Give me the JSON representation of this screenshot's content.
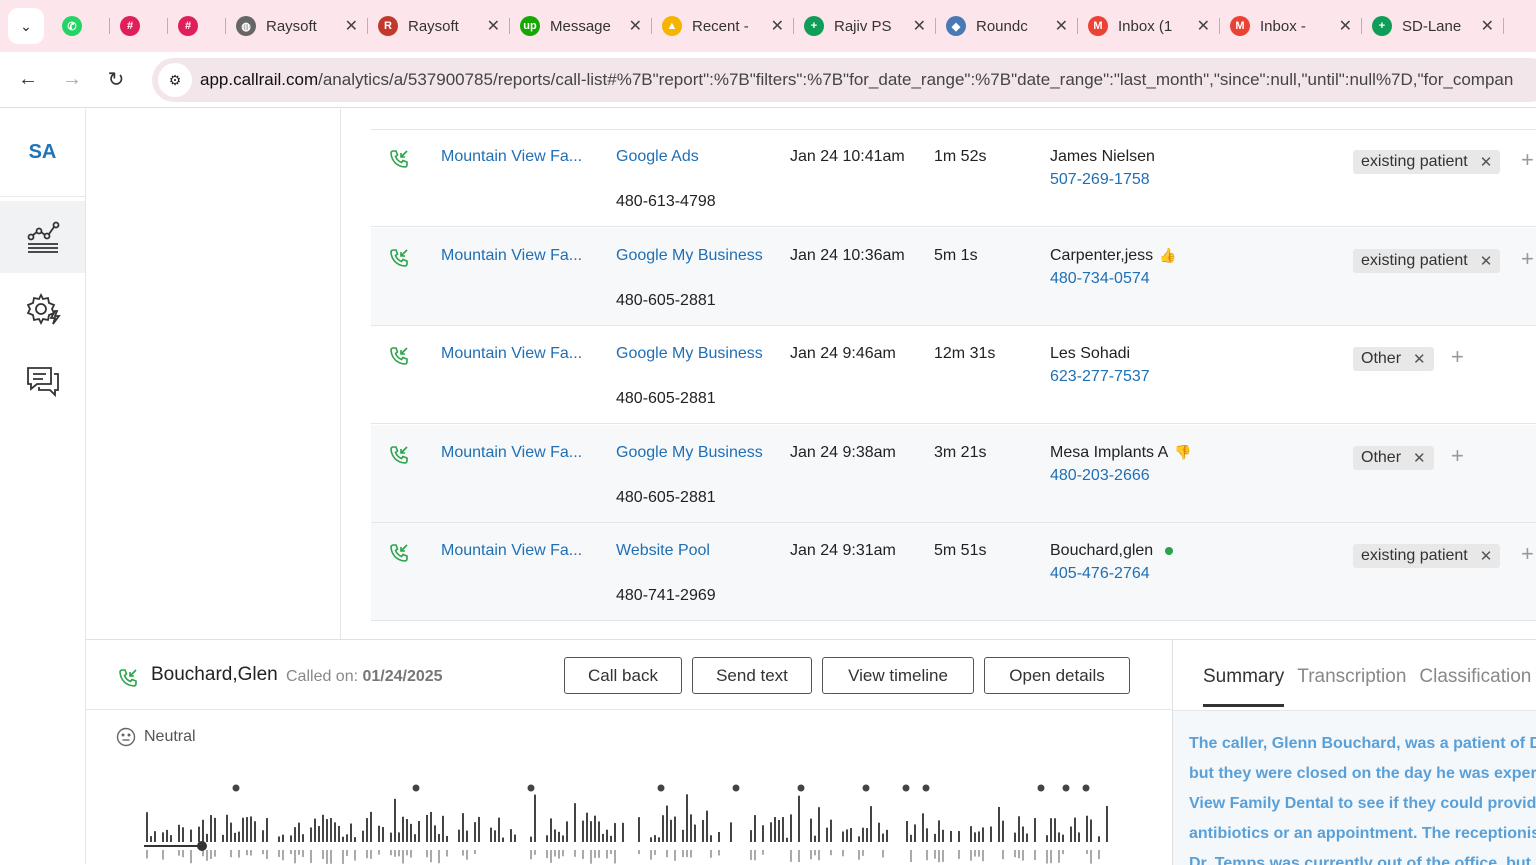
{
  "browser": {
    "tabs": [
      {
        "label": "",
        "icon": "whatsapp-icon",
        "color": "#25d366",
        "glyph": "✆",
        "small": true
      },
      {
        "label": "",
        "icon": "slack-icon",
        "color": "#e01e5a",
        "glyph": "#",
        "small": true
      },
      {
        "label": "",
        "icon": "slack-icon",
        "color": "#e01e5a",
        "glyph": "#",
        "small": true
      },
      {
        "label": "Raysoft",
        "icon": "globe-icon",
        "color": "#666666",
        "glyph": "◍"
      },
      {
        "label": "Raysoft",
        "icon": "raysoft-icon",
        "color": "#c0392b",
        "glyph": "R"
      },
      {
        "label": "Message",
        "icon": "upwork-icon",
        "color": "#14a800",
        "glyph": "up"
      },
      {
        "label": "Recent -",
        "icon": "drive-icon",
        "color": "#f4b400",
        "glyph": "▲"
      },
      {
        "label": "Rajiv PS",
        "icon": "sheets-icon",
        "color": "#0f9d58",
        "glyph": "+"
      },
      {
        "label": "Roundc",
        "icon": "roundcube-icon",
        "color": "#4a7ab5",
        "glyph": "◆"
      },
      {
        "label": "Inbox (1",
        "icon": "gmail-icon",
        "color": "#ea4335",
        "glyph": "M"
      },
      {
        "label": "Inbox -",
        "icon": "gmail-icon",
        "color": "#ea4335",
        "glyph": "M"
      },
      {
        "label": "SD-Lane",
        "icon": "sheets-icon",
        "color": "#0f9d58",
        "glyph": "+"
      }
    ],
    "url_host": "app.callrail.com",
    "url_path": "/analytics/a/537900785/reports/call-list#%7B\"report\":%7B\"filters\":%7B\"for_date_range\":%7B\"date_range\":\"last_month\",\"since\":null,\"until\":null%7D,\"for_compan"
  },
  "rail": {
    "logo": "SA"
  },
  "calls": [
    {
      "company": "Mountain View Fa...",
      "source": "Google Ads",
      "tracking": "480-613-4798",
      "date": "Jan 24 10:41am",
      "duration": "1m 52s",
      "caller": "James Nielsen",
      "caller_phone": "507-269-1758",
      "marker": "",
      "tag": "existing patient"
    },
    {
      "company": "Mountain View Fa...",
      "source": "Google My Business",
      "tracking": "480-605-2881",
      "date": "Jan 24 10:36am",
      "duration": "5m 1s",
      "caller": "Carpenter,jess",
      "caller_phone": "480-734-0574",
      "marker": "thumbs-up",
      "tag": "existing patient"
    },
    {
      "company": "Mountain View Fa...",
      "source": "Google My Business",
      "tracking": "480-605-2881",
      "date": "Jan 24 9:46am",
      "duration": "12m 31s",
      "caller": "Les Sohadi",
      "caller_phone": "623-277-7537",
      "marker": "",
      "tag": "Other"
    },
    {
      "company": "Mountain View Fa...",
      "source": "Google My Business",
      "tracking": "480-605-2881",
      "date": "Jan 24 9:38am",
      "duration": "3m 21s",
      "caller": "Mesa Implants A",
      "caller_phone": "480-203-2666",
      "marker": "thumbs-down",
      "tag": "Other"
    },
    {
      "company": "Mountain View Fa...",
      "source": "Website Pool",
      "tracking": "480-741-2969",
      "date": "Jan 24 9:31am",
      "duration": "5m 51s",
      "caller": "Bouchard,glen",
      "caller_phone": "405-476-2764",
      "marker": "dot",
      "tag": "existing patient"
    }
  ],
  "detail": {
    "caller_name": "Bouchard,Glen",
    "called_on_label": "Called on:",
    "called_on_date": "01/24/2025",
    "buttons": {
      "call_back": "Call back",
      "send_text": "Send text",
      "view_timeline": "View timeline",
      "open_details": "Open details"
    },
    "sentiment": "Neutral",
    "tabs": {
      "summary": "Summary",
      "transcription": "Transcription",
      "classification": "Classification"
    },
    "summary_lines": [
      "The caller, Glenn Bouchard, was a patient of Dr",
      "but they were closed on the day he was experie",
      "View Family Dental to see if they could provide",
      "antibiotics or an appointment. The receptionis",
      "Dr. Temps was currently out of the office, but s"
    ]
  },
  "colors": {
    "link": "#1f6fb5",
    "accent": "#2aa44a",
    "summary": "#5aa0d8"
  }
}
